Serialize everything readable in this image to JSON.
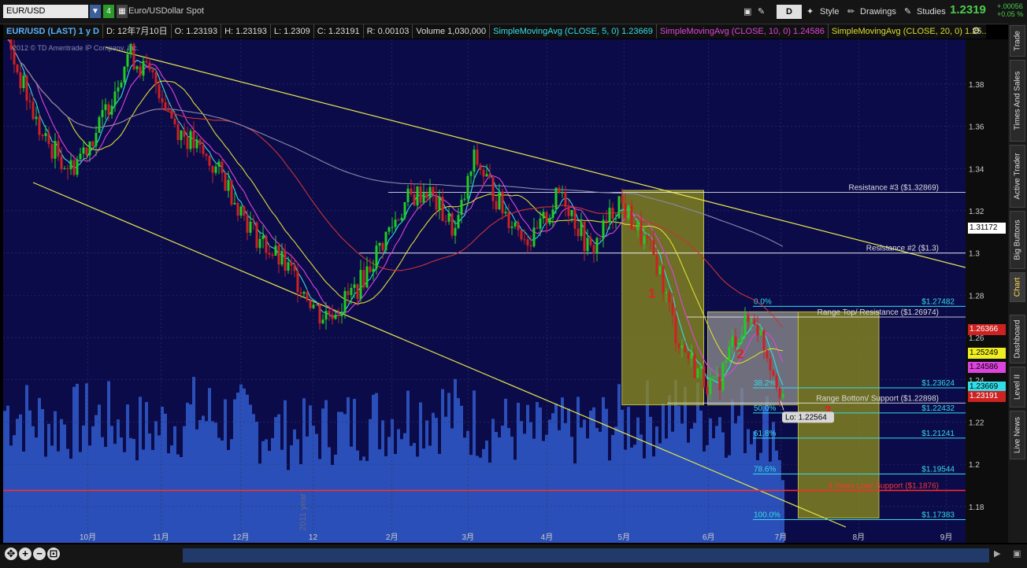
{
  "header": {
    "symbol": "EUR/USD",
    "period_badge": "4",
    "description": "Euro/USDollar Spot",
    "d_button": "D",
    "style_label": "Style",
    "drawings_label": "Drawings",
    "studies_label": "Studies",
    "last_price": "1.2319",
    "change_abs": "+.00056",
    "change_pct": "+0.05 %"
  },
  "infobar": {
    "title": "EUR/USD (LAST) 1 y D",
    "date": "D: 12年7月10日",
    "open": "O: 1.23193",
    "high": "H: 1.23193",
    "low": "L: 1.2309",
    "close": "C: 1.23191",
    "range": "R: 0.00103",
    "volume": "Volume 1,030,000",
    "sma5": "SimpleMovingAvg (CLOSE, 5, 0) 1.23669",
    "sma10": "SimpleMovingAvg (CLOSE, 10, 0) 1.24586",
    "sma20": "SimpleMovingAvg (CLOSE, 20, 0) 1.25..."
  },
  "watermark": "2012 © TD Ameritrade IP Company, Inc.",
  "year_label": "2011 year",
  "side_tabs": [
    "Trade",
    "Times And Sales",
    "Active Trader",
    "Big Buttons",
    "Chart",
    "Dashboard",
    "Level II",
    "Live News"
  ],
  "chart_data": {
    "type": "candlestick",
    "title": "EUR/USD (LAST) 1 y D",
    "x_ticks": [
      "10月",
      "11月",
      "12月",
      "12",
      "2月",
      "3月",
      "4月",
      "5月",
      "6月",
      "7月",
      "8月",
      "9月"
    ],
    "x_tick_frac": [
      0.088,
      0.164,
      0.247,
      0.322,
      0.404,
      0.483,
      0.565,
      0.645,
      0.733,
      0.808,
      0.889,
      0.98
    ],
    "y_ticks": [
      1.18,
      1.2,
      1.22,
      1.24,
      1.26,
      1.28,
      1.3,
      1.32,
      1.34,
      1.36,
      1.38
    ],
    "ylim": [
      1.1628,
      1.4012
    ],
    "colors": {
      "up": "#22cc22",
      "down": "#cc2222",
      "volume": "#2a4fb8",
      "background": "#0b0b4a",
      "sma5": "#33dde8",
      "sma10": "#dd44dd",
      "sma20": "#dddd33",
      "sma50": "#cc3333",
      "sma200": "#8a8aaa"
    },
    "price_path": {
      "x": [
        0.0,
        0.02,
        0.04,
        0.07,
        0.1,
        0.13,
        0.16,
        0.18,
        0.2,
        0.23,
        0.26,
        0.29,
        0.31,
        0.33,
        0.35,
        0.37,
        0.4,
        0.42,
        0.44,
        0.47,
        0.49,
        0.52,
        0.55,
        0.58,
        0.61,
        0.64,
        0.66,
        0.68,
        0.7,
        0.72,
        0.74,
        0.76,
        0.78,
        0.8,
        0.811
      ],
      "y": [
        1.405,
        1.38,
        1.355,
        1.34,
        1.36,
        1.395,
        1.38,
        1.36,
        1.35,
        1.335,
        1.31,
        1.295,
        1.285,
        1.27,
        1.275,
        1.285,
        1.31,
        1.325,
        1.33,
        1.31,
        1.345,
        1.32,
        1.305,
        1.33,
        1.3,
        1.325,
        1.31,
        1.295,
        1.26,
        1.245,
        1.235,
        1.26,
        1.27,
        1.245,
        1.2319
      ]
    },
    "volume_path": {
      "x": [
        0.0,
        0.05,
        0.1,
        0.15,
        0.2,
        0.25,
        0.3,
        0.35,
        0.4,
        0.45,
        0.5,
        0.55,
        0.6,
        0.65,
        0.7,
        0.75,
        0.8,
        0.811
      ],
      "level": [
        0.62,
        0.55,
        0.58,
        0.52,
        0.6,
        0.56,
        0.5,
        0.54,
        0.58,
        0.62,
        0.55,
        0.5,
        0.52,
        0.57,
        0.6,
        0.58,
        0.55,
        0.3
      ]
    },
    "levels": [
      {
        "label": "Resistance #3 ($1.32869)",
        "price": 1.3287,
        "color": "#ffffff",
        "from": 0.4
      },
      {
        "label": "Resistance #2 ($1.3)",
        "price": 1.3,
        "color": "#ffffff",
        "from": 0.37
      },
      {
        "label": "Range Top/ Resistance ($1.26974)",
        "price": 1.2697,
        "color": "#ffffff",
        "from": 0.71
      },
      {
        "label": "Range Bottom/ Support ($1.22898)",
        "price": 1.229,
        "color": "#ffffff",
        "from": 0.69
      },
      {
        "label": "3 Years Low/ Support ($1.1876)",
        "price": 1.1876,
        "color": "#ff2a2a",
        "from": 0.0
      }
    ],
    "fibonacci": [
      {
        "pct": "0.0%",
        "value": "$1.27482",
        "price": 1.2748
      },
      {
        "pct": "38.2%",
        "value": "$1.23624",
        "price": 1.2362
      },
      {
        "pct": "50.0%",
        "value": "$1.22432",
        "price": 1.2243
      },
      {
        "pct": "61.8%",
        "value": "$1.21241",
        "price": 1.2124
      },
      {
        "pct": "78.6%",
        "value": "$1.19544",
        "price": 1.1954
      },
      {
        "pct": "100.0%",
        "value": "$1.17383",
        "price": 1.1738
      }
    ],
    "zones": [
      {
        "label": "1",
        "x0": 0.643,
        "x1": 0.728,
        "y0": 1.3297,
        "y1": 1.2281,
        "color": "#8a8a1e"
      },
      {
        "label": "2",
        "x0": 0.732,
        "x1": 0.826,
        "y0": 1.2722,
        "y1": 1.2281,
        "color": "#8a8a8a"
      },
      {
        "label": "3",
        "x0": 0.826,
        "x1": 0.91,
        "y0": 1.2722,
        "y1": 1.1745,
        "color": "#8a8a1e"
      }
    ],
    "low_annotation": "Lo: 1.22564",
    "low_price": 1.2256,
    "price_boxes": [
      {
        "text": "1.31172",
        "price": 1.3117,
        "bg": "#ffffff",
        "fg": "#000000"
      },
      {
        "text": "1.26366",
        "price": 1.2637,
        "bg": "#cc2222",
        "fg": "#ffffff"
      },
      {
        "text": "1.25249",
        "price": 1.2525,
        "bg": "#eeee22",
        "fg": "#000000"
      },
      {
        "text": "1.24586",
        "price": 1.2459,
        "bg": "#dd44dd",
        "fg": "#000000"
      },
      {
        "text": "1.23669",
        "price": 1.2367,
        "bg": "#33dde8",
        "fg": "#000000"
      },
      {
        "text": "1.23191",
        "price": 1.2319,
        "bg": "#cc2222",
        "fg": "#ffffff"
      }
    ]
  }
}
